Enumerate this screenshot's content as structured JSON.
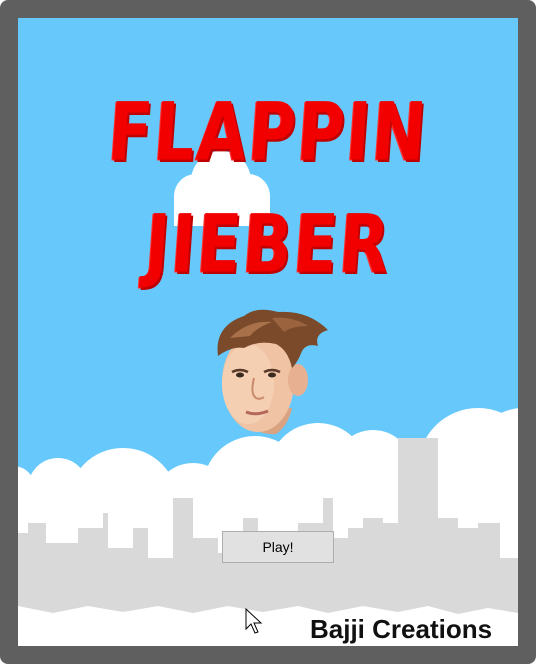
{
  "game": {
    "title_line1": "FLAPPIN",
    "title_line2": "JIEBER",
    "play_label": "Play!",
    "credits": "Bajji Creations"
  },
  "colors": {
    "sky": "#66c8fb",
    "title": "#f20000",
    "cloud": "#ffffff",
    "city": "#d8d8d8",
    "window_frame": "#5f5f5f"
  },
  "icons": {
    "player_character": "character-face-sprite",
    "cursor": "arrow-cursor-icon"
  }
}
